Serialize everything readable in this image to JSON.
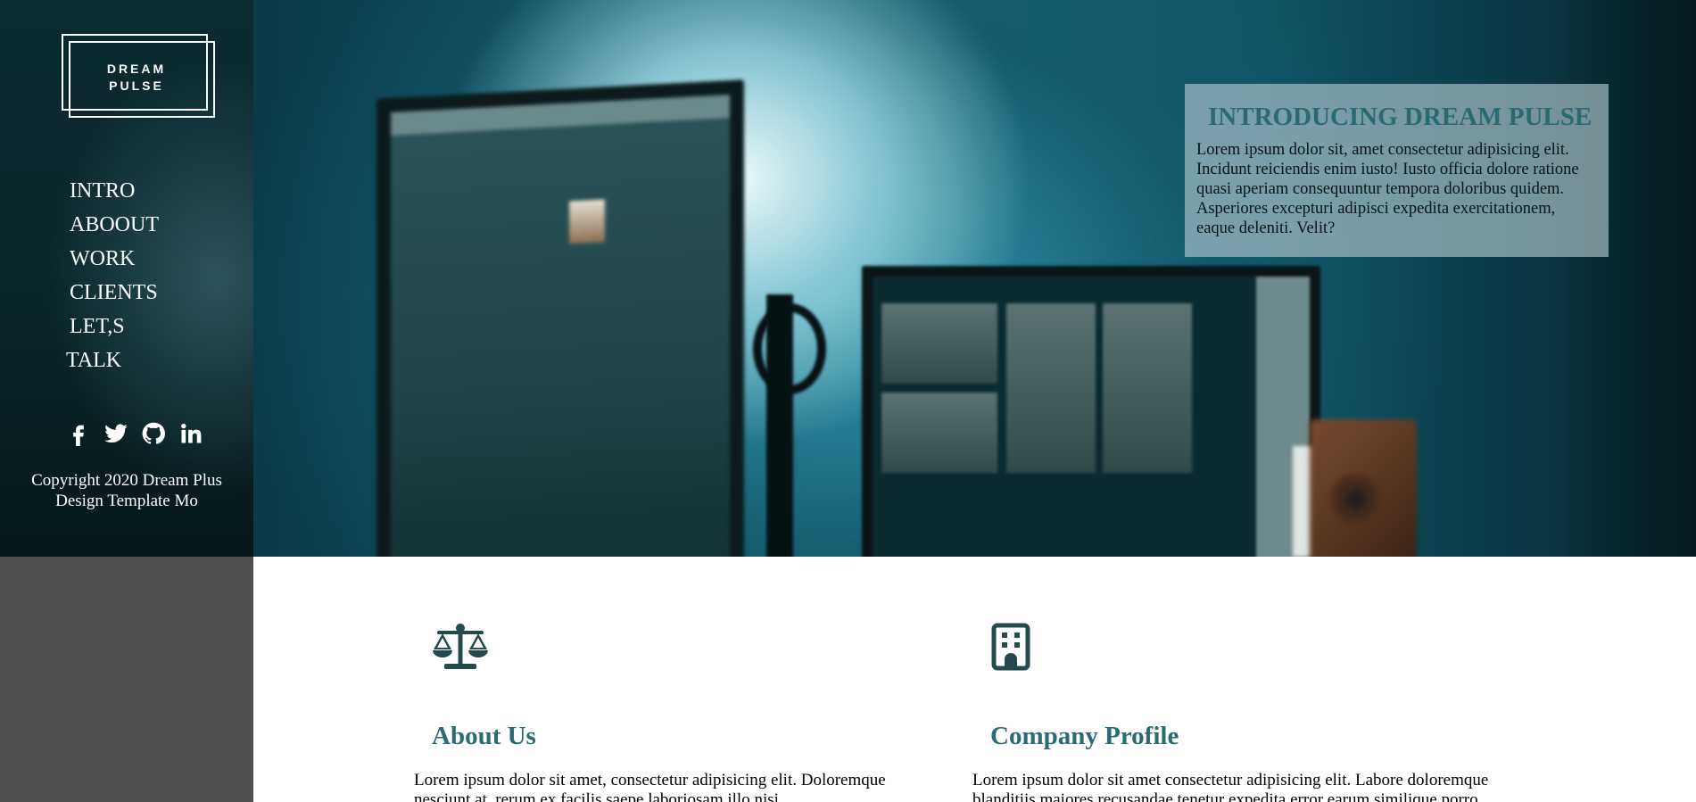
{
  "sidebar": {
    "logo": {
      "line1": "DREAM",
      "line2": "PULSE"
    },
    "nav": [
      {
        "label": "INTRO"
      },
      {
        "label": "ABOOUT"
      },
      {
        "label": "WORK"
      },
      {
        "label": "CLIENTS"
      },
      {
        "label": "LET,S"
      },
      {
        "label": "TALK"
      }
    ],
    "socials": [
      {
        "icon": "facebook-icon"
      },
      {
        "icon": "twitter-icon"
      },
      {
        "icon": "github-icon"
      },
      {
        "icon": "linkedin-icon"
      }
    ],
    "copyright": {
      "line1": "Copyright 2020 Dream Plus",
      "line2": "Design Template Mo"
    }
  },
  "hero": {
    "intro_title": "INTRODUCING DREAM PULSE",
    "intro_text": "Lorem ipsum dolor sit, amet consectetur adipisicing elit. Incidunt reiciendis enim iusto! Iusto officia dolore ratione quasi aperiam consequuntur tempora doloribus quidem. Asperiores excepturi adipisci expedita exercitationem, eaque deleniti. Velit?"
  },
  "features": [
    {
      "icon": "balance-scale-icon",
      "title": "About Us",
      "text": "Lorem ipsum dolor sit amet, consectetur adipisicing elit. Doloremque nesciunt at, rerum ex facilis saepe laboriosam illo nisi"
    },
    {
      "icon": "building-icon",
      "title": "Company Profile",
      "text": "Lorem ipsum dolor sit amet consectetur adipisicing elit. Labore doloremque blanditiis maiores recusandae tenetur expedita error earum similique porro"
    }
  ],
  "colors": {
    "accent": "#2a6b73",
    "sidebar_bg": "#524f50",
    "sidebar_top": "#0b2b31"
  }
}
